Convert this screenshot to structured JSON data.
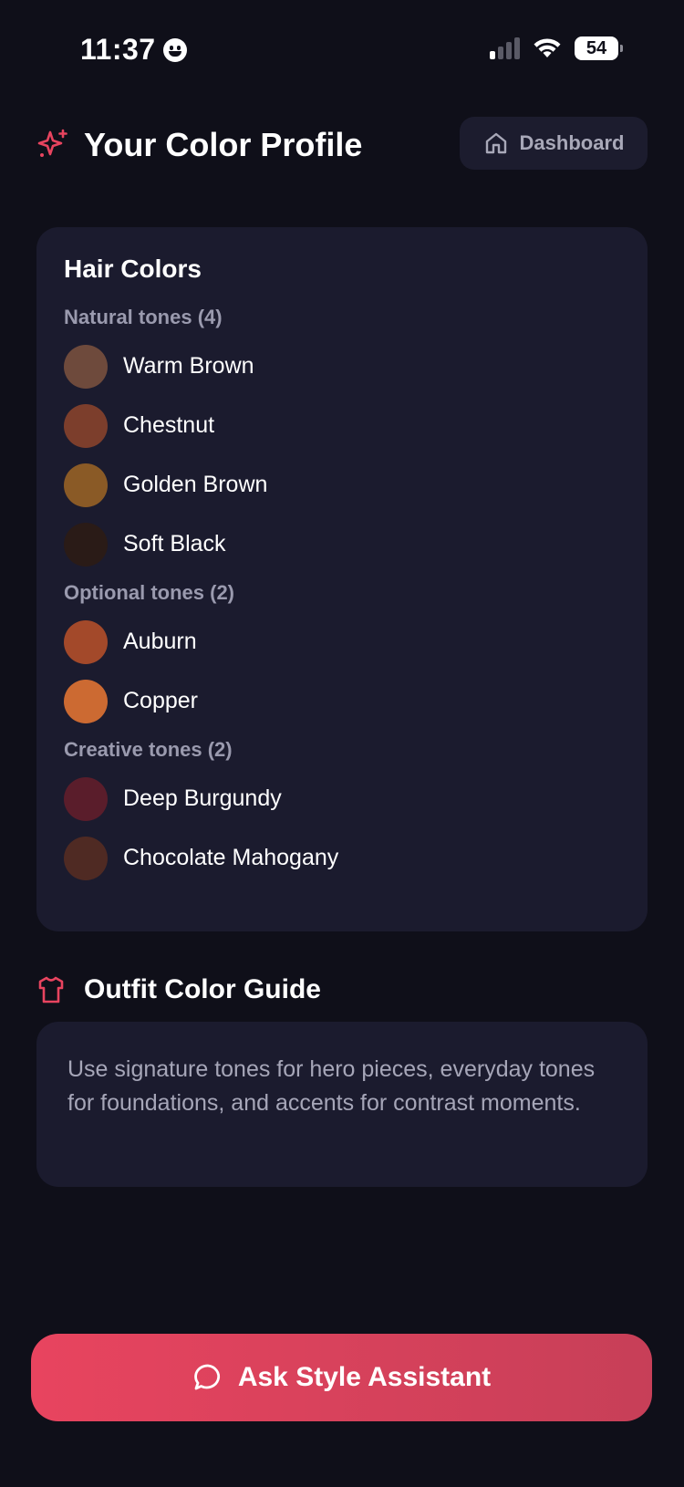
{
  "status_bar": {
    "time": "11:37",
    "battery": "54"
  },
  "header": {
    "title": "Your Color Profile",
    "dashboard_label": "Dashboard",
    "accent": "#e8445f"
  },
  "hair_colors": {
    "title": "Hair Colors",
    "groups": [
      {
        "label": "Natural tones (4)",
        "swatches": [
          {
            "name": "Warm Brown",
            "color": "#6e4a3c"
          },
          {
            "name": "Chestnut",
            "color": "#7c3e2c"
          },
          {
            "name": "Golden Brown",
            "color": "#8a5a26"
          },
          {
            "name": "Soft Black",
            "color": "#2a1b17"
          }
        ]
      },
      {
        "label": "Optional tones (2)",
        "swatches": [
          {
            "name": "Auburn",
            "color": "#a3492a"
          },
          {
            "name": "Copper",
            "color": "#cc6a32"
          }
        ]
      },
      {
        "label": "Creative tones (2)",
        "swatches": [
          {
            "name": "Deep Burgundy",
            "color": "#5a1d2b"
          },
          {
            "name": "Chocolate Mahogany",
            "color": "#4f2a23"
          }
        ]
      }
    ]
  },
  "outfit_guide": {
    "title": "Outfit Color Guide",
    "text": "Use signature tones for hero pieces, everyday tones for foundations, and accents for contrast moments."
  },
  "assistant_button": {
    "label": "Ask Style Assistant"
  }
}
